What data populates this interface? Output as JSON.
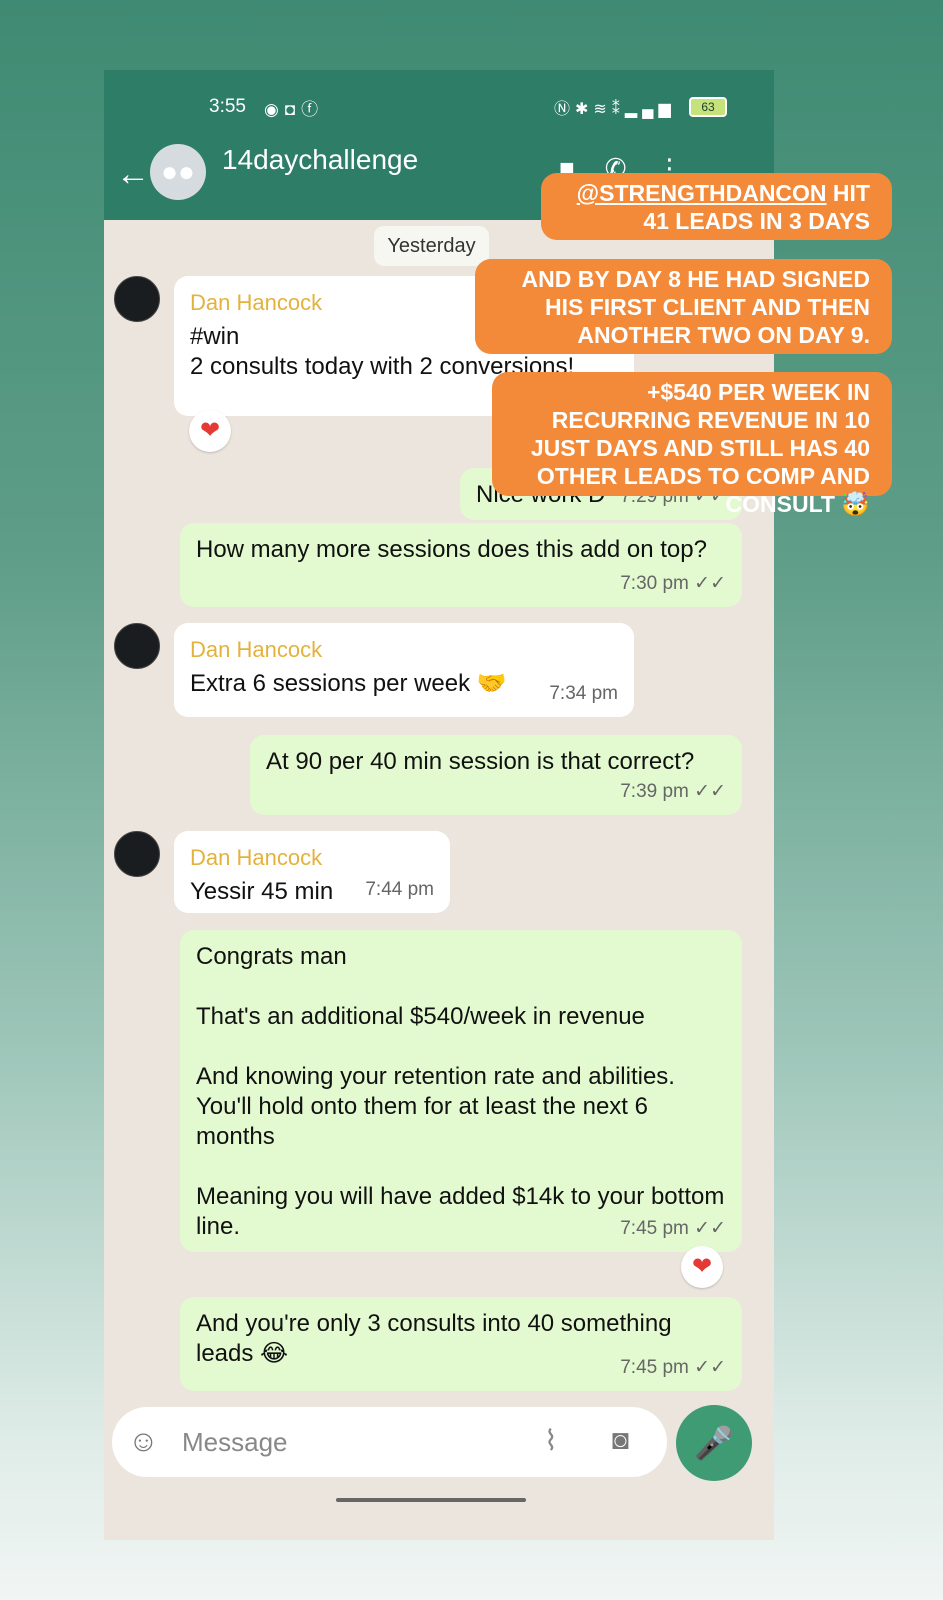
{
  "status_bar": {
    "time": "3:55",
    "app_icons": [
      "messenger-icon",
      "instagram-icon",
      "facebook-icon"
    ],
    "system_icons": [
      "nfc-icon",
      "bluetooth-icon",
      "wifi-icon",
      "volte-icon",
      "signal-icon"
    ],
    "battery": "63"
  },
  "header": {
    "chat_title": "14daychallenge",
    "icons": [
      "back-arrow-icon",
      "group-avatar-icon",
      "video-call-icon",
      "phone-call-icon",
      "more-vertical-icon"
    ]
  },
  "chat": {
    "date_chip": "Yesterday",
    "messages": [
      {
        "sender": "Dan Hancock",
        "text": "#win\n2 consults today with 2 conversions!",
        "reaction": "❤"
      },
      {
        "text": "Nice work D",
        "time": "7:29 pm"
      },
      {
        "text": "How many more sessions does this add on top?",
        "time": "7:30 pm"
      },
      {
        "sender": "Dan Hancock",
        "text": "Extra 6 sessions per week 🤝",
        "time": "7:34 pm"
      },
      {
        "text": "At 90 per 40 min session is that correct?",
        "time": "7:39 pm"
      },
      {
        "sender": "Dan Hancock",
        "text": "Yessir 45 min",
        "time": "7:44 pm"
      },
      {
        "text": "Congrats man\n\nThat's an additional $540/week in revenue\n\nAnd knowing your retention rate and abilities. You'll hold onto them for at least the next 6 months\n\nMeaning you will have added $14k to your bottom line.",
        "time": "7:45 pm",
        "reaction": "❤"
      },
      {
        "text": "And you're only 3 consults into 40 something leads 😂",
        "time": "7:45 pm"
      }
    ]
  },
  "input": {
    "placeholder": "Message"
  },
  "story_captions": {
    "caption_1_tag": "@STRENGTHDANCON",
    "caption_1_rest": " HIT 41 LEADS IN 3 DAYS",
    "caption_2": "AND BY DAY 8 HE HAD SIGNED HIS FIRST CLIENT AND THEN ANOTHER TWO ON DAY 9.",
    "caption_3": "+$540 PER WEEK IN RECURRING REVENUE IN 10 JUST DAYS AND STILL HAS 40 OTHER LEADS TO COMP AND CONSULT 🤯"
  },
  "colors": {
    "header_green": "#2e7d66",
    "outgoing_bubble": "#e3fad0",
    "sender_name": "#e3b23c",
    "caption_orange": "#f28a3a",
    "mic_button": "#3f9b74"
  }
}
